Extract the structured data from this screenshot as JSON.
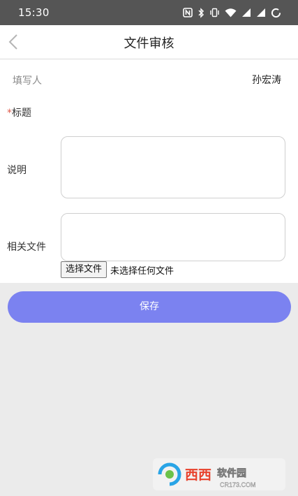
{
  "status_bar": {
    "time": "15:30"
  },
  "header": {
    "title": "文件审核",
    "back_icon": "chevron-left-icon"
  },
  "form": {
    "filler_label": "填写人",
    "filler_value": "孙宏涛",
    "title_required_mark": "*",
    "title_label": "标题",
    "description_label": "说明",
    "description_value": "",
    "related_files_label": "相关文件",
    "related_files_value": "",
    "choose_file_button": "选择文件",
    "no_file_selected": "未选择任何文件"
  },
  "actions": {
    "save_label": "保存"
  },
  "watermark": {
    "brand": "西西软件园",
    "domain": "CR173.COM"
  },
  "colors": {
    "status_bar": "#555555",
    "save_button": "#7b82f0",
    "required_star": "#e05a4a",
    "page_background": "#ebebeb"
  }
}
